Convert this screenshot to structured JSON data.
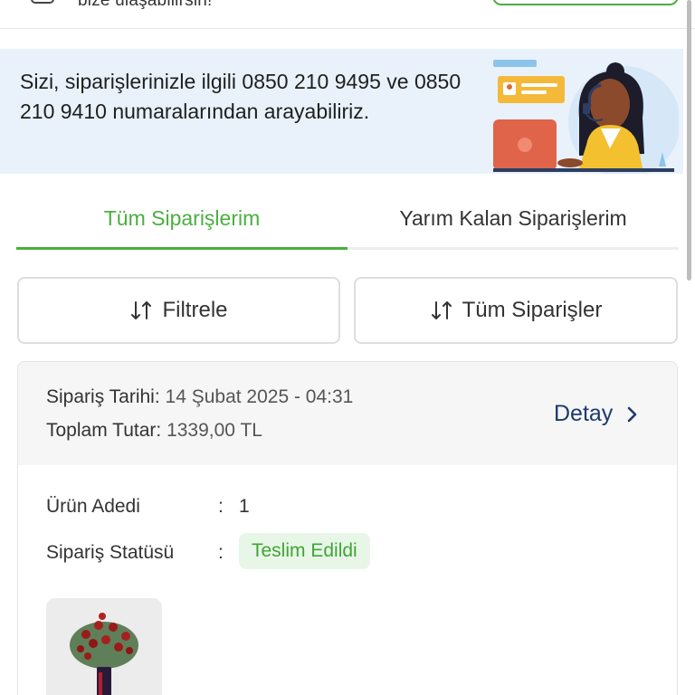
{
  "top": {
    "text": "bize ulaşabilirsin!"
  },
  "banner": {
    "text": "Sizi, siparişlerinizle ilgili 0850 210 9495 ve 0850 210 9410 numaralarından arayabiliriz."
  },
  "tabs": [
    {
      "label": "Tüm Siparişlerim",
      "active": true
    },
    {
      "label": "Yarım Kalan Siparişlerim",
      "active": false
    }
  ],
  "buttons": {
    "filter_label": "Filtrele",
    "all_label": "Tüm Siparişler"
  },
  "order": {
    "date_label": "Sipariş Tarihi:",
    "date_value": "14 Şubat 2025 - 04:31",
    "total_label": "Toplam Tutar:",
    "total_value": "1339,00 TL",
    "detail_label": "Detay",
    "qty_label": "Ürün Adedi",
    "qty_value": "1",
    "status_label": "Sipariş Statüsü",
    "status_value": "Teslim Edildi"
  },
  "icons": [
    "chat-icon",
    "sort-icon",
    "chevron-right-icon",
    "support-agent-illustration",
    "product-image"
  ],
  "colors": {
    "accent_green": "#4caf3f",
    "link_blue": "#1d3a6e",
    "banner_bg": "#e9f2fb",
    "badge_bg": "#e8f6e8"
  }
}
